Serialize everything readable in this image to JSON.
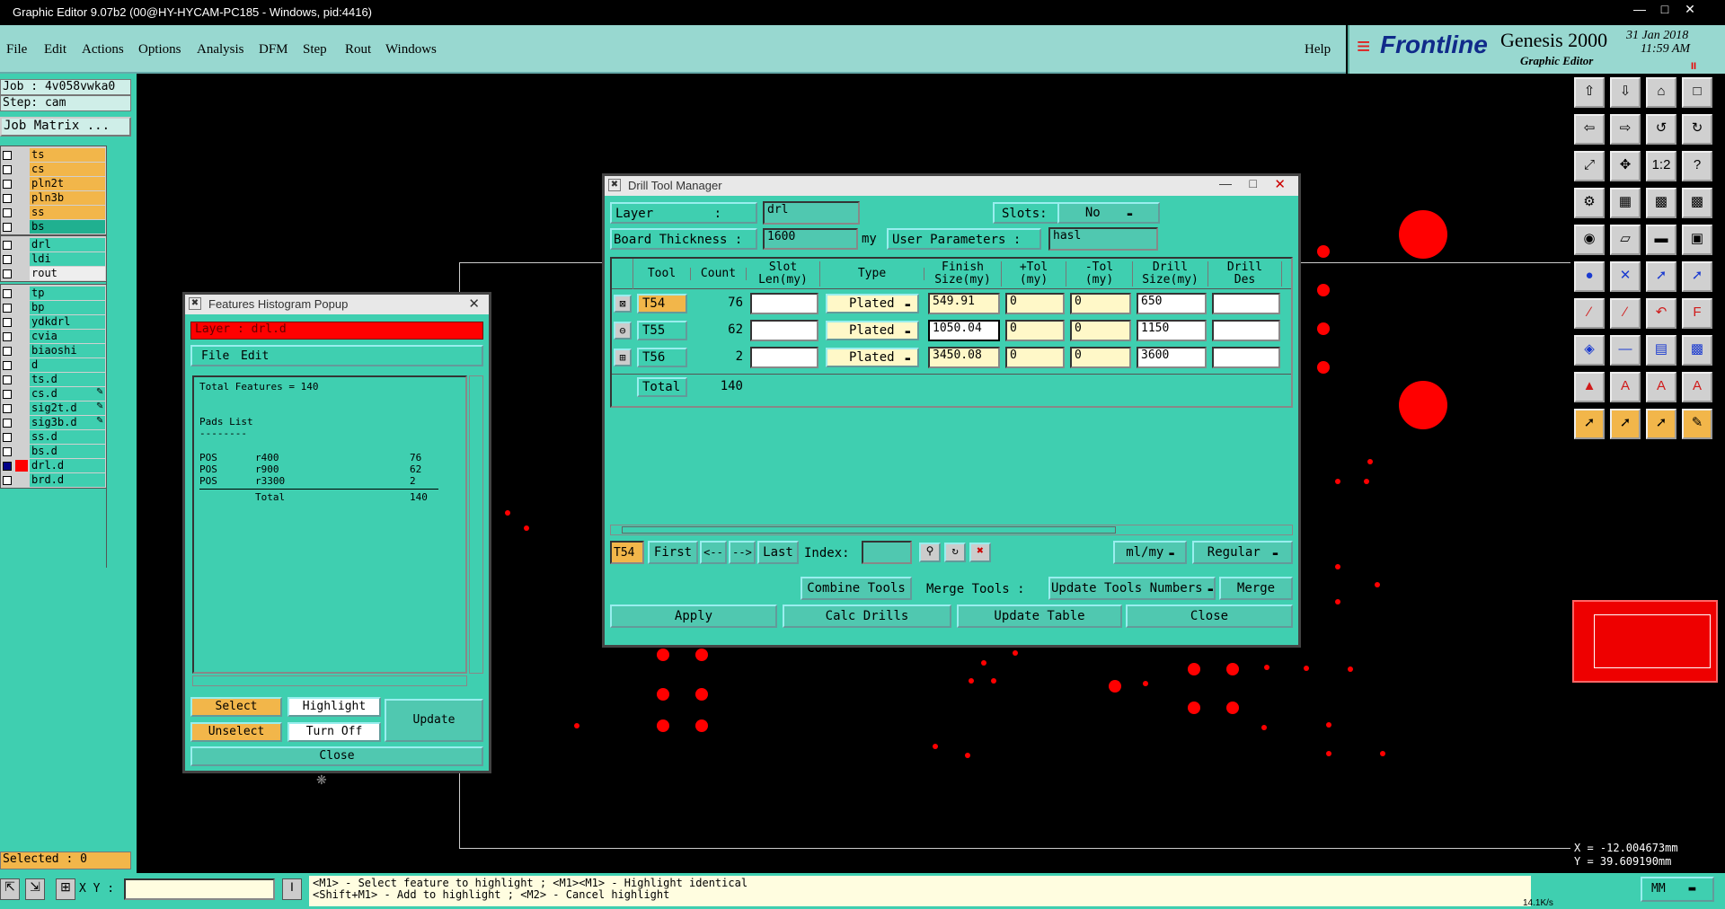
{
  "window": {
    "title": "Graphic Editor 9.07b2 (00@HY-HYCAM-PC185 - Windows, pid:4416)"
  },
  "menu": [
    "File",
    "Edit",
    "Actions",
    "Options",
    "Analysis",
    "DFM",
    "Step",
    "Rout",
    "Windows"
  ],
  "help": "Help",
  "logo": {
    "brand": "Frontline",
    "product": "Genesis 2000",
    "subtitle": "Graphic Editor",
    "date": "31 Jan 2018",
    "time": "11:59 AM"
  },
  "left": {
    "job": "Job : 4v058vwka0",
    "step": "Step: cam",
    "job_matrix": "Job Matrix ...",
    "layers_a": [
      "ts",
      "cs",
      "pln2t",
      "pln3b",
      "ss",
      "bs"
    ],
    "layers_b": [
      "drl",
      "ldi",
      "rout"
    ],
    "layers_c": [
      "tp",
      "bp",
      "ydkdrl",
      "cvia",
      "biaoshi",
      "d",
      "ts.d",
      "cs.d",
      "sig2t.d",
      "sig3b.d",
      "ss.d",
      "bs.d",
      "drl.d",
      "brd.d"
    ],
    "selected": "Selected : 0"
  },
  "status": {
    "xy_label": "X Y :",
    "hint1": "<M1> - Select feature to highlight ; <M1><M1> - Highlight identical",
    "hint2": "<Shift+M1> - Add to highlight ; <M2> - Cancel highlight",
    "units": "MM",
    "speed": "14.1K/s"
  },
  "coords": {
    "x": "X = -12.004673mm",
    "y": "Y = 39.609190mm"
  },
  "histogram": {
    "title": "Features Histogram Popup",
    "layer": "Layer : drl.d",
    "menu": [
      "File",
      "Edit"
    ],
    "total": "Total Features = 140",
    "pads_title": "Pads List",
    "dashes": "--------",
    "rows": [
      [
        "POS",
        "r400",
        "76"
      ],
      [
        "POS",
        "r900",
        "62"
      ],
      [
        "POS",
        "r3300",
        "2"
      ]
    ],
    "total_label": "Total",
    "total_value": "140",
    "buttons": {
      "select": "Select",
      "highlight": "Highlight",
      "update": "Update",
      "unselect": "Unselect",
      "turn_off": "Turn Off",
      "close": "Close"
    }
  },
  "dtm": {
    "title": "Drill Tool Manager",
    "layer_label": "Layer        :",
    "layer_value": "drl",
    "slots_label": "Slots:",
    "slots_value": "No",
    "thickness_label": "Board Thickness :",
    "thickness_value": "1600",
    "thickness_unit": "my",
    "user_params_label": "User Parameters :",
    "user_params_value": "hasl",
    "headers": [
      "Tool",
      "Count",
      "Slot\nLen(my)",
      "Type",
      "Finish\nSize(my)",
      "+Tol\n(my)",
      "-Tol\n(my)",
      "Drill\nSize(my)",
      "Drill\nDes"
    ],
    "rows": [
      {
        "tool": "T54",
        "count": "76",
        "type": "Plated",
        "finish": "549.91",
        "ptol": "0",
        "ntol": "0",
        "drill": "650"
      },
      {
        "tool": "T55",
        "count": "62",
        "type": "Plated",
        "finish": "1050.04",
        "ptol": "0",
        "ntol": "0",
        "drill": "1150"
      },
      {
        "tool": "T56",
        "count": "2",
        "type": "Plated",
        "finish": "3450.08",
        "ptol": "0",
        "ntol": "0",
        "drill": "3600"
      }
    ],
    "total_label": "Total",
    "total_count": "140",
    "nav": {
      "current": "T54",
      "first": "First",
      "prev": "<--",
      "next": "-->",
      "last": "Last",
      "index": "Index:",
      "units": "ml/my",
      "mode": "Regular"
    },
    "combine": "Combine Tools",
    "merge_label": "Merge Tools :",
    "update_numbers": "Update Tools Numbers",
    "merge": "Merge",
    "apply": "Apply",
    "calc": "Calc Drills",
    "update_table": "Update Table",
    "close": "Close"
  },
  "colors": {
    "teal": "#3fcfb0",
    "orange": "#f2b64a",
    "red": "#ff0000"
  }
}
